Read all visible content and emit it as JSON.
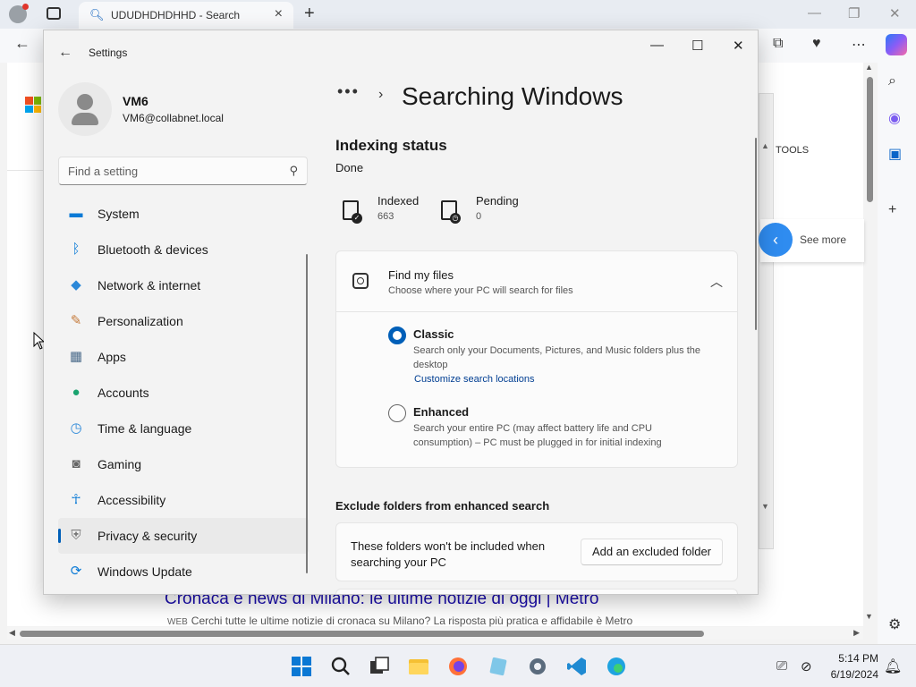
{
  "browser": {
    "tab_title": "UDUDHDHDHHD - Search",
    "tools_label": "TOOLS",
    "see_more": "See more",
    "news_title": "Cronaca e news di Milano: le ultime notizie di oggi | Metro",
    "news_source_tag": "WEB",
    "news_snippet": "Cerchi tutte le ultime notizie di cronaca su Milano? La risposta più pratica e affidabile è Metro"
  },
  "settings": {
    "window_title": "Settings",
    "user": {
      "name": "VM6",
      "email": "VM6@collabnet.local"
    },
    "search_placeholder": "Find a setting",
    "nav": [
      {
        "label": "System",
        "icon": "monitor-icon",
        "active": false
      },
      {
        "label": "Bluetooth & devices",
        "icon": "bluetooth-icon",
        "active": false
      },
      {
        "label": "Network & internet",
        "icon": "wifi-icon",
        "active": false
      },
      {
        "label": "Personalization",
        "icon": "brush-icon",
        "active": false
      },
      {
        "label": "Apps",
        "icon": "apps-icon",
        "active": false
      },
      {
        "label": "Accounts",
        "icon": "person-icon",
        "active": false
      },
      {
        "label": "Time & language",
        "icon": "clock-globe-icon",
        "active": false
      },
      {
        "label": "Gaming",
        "icon": "gamepad-icon",
        "active": false
      },
      {
        "label": "Accessibility",
        "icon": "accessibility-icon",
        "active": false
      },
      {
        "label": "Privacy & security",
        "icon": "shield-icon",
        "active": true
      },
      {
        "label": "Windows Update",
        "icon": "update-icon",
        "active": false
      }
    ],
    "breadcrumb_more": "•••",
    "page_title": "Searching Windows",
    "indexing": {
      "heading": "Indexing status",
      "status": "Done",
      "indexed_label": "Indexed",
      "indexed_value": "663",
      "pending_label": "Pending",
      "pending_value": "0"
    },
    "find_my_files": {
      "title": "Find my files",
      "subtitle": "Choose where your PC will search for files",
      "classic_title": "Classic",
      "classic_desc": "Search only your Documents, Pictures, and Music folders plus the desktop",
      "classic_link": "Customize search locations",
      "classic_selected": true,
      "enhanced_title": "Enhanced",
      "enhanced_desc": "Search your entire PC (may affect battery life and CPU consumption) – PC must be plugged in for initial indexing",
      "enhanced_selected": false
    },
    "exclude": {
      "heading": "Exclude folders from enhanced search",
      "text": "These folders won't be included when searching your PC",
      "button": "Add an excluded folder"
    }
  },
  "taskbar": {
    "time": "5:14 PM",
    "date": "6/19/2024"
  },
  "colors": {
    "accent": "#005fb8",
    "link": "#003e92"
  }
}
